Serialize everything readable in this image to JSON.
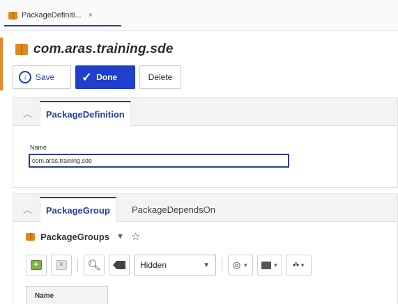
{
  "tab": {
    "label": "PackageDefiniti...",
    "close": "×"
  },
  "item": {
    "title": "com.aras.training.sde"
  },
  "toolbar": {
    "save_label": "Save",
    "done_label": "Done",
    "delete_label": "Delete"
  },
  "definition_section": {
    "tab_label": "PackageDefinition",
    "field_label": "Name",
    "field_value": "com.aras.training.sde"
  },
  "relationships": {
    "tabs": [
      "PackageGroup",
      "PackageDependsOn"
    ],
    "grid_title": "PackageGroups",
    "view_select": "Hidden",
    "columns": [
      "Name"
    ]
  },
  "colors": {
    "accent": "#1f3fa3",
    "done_button": "#1f3fcc",
    "item_bar": "#e4892a"
  }
}
